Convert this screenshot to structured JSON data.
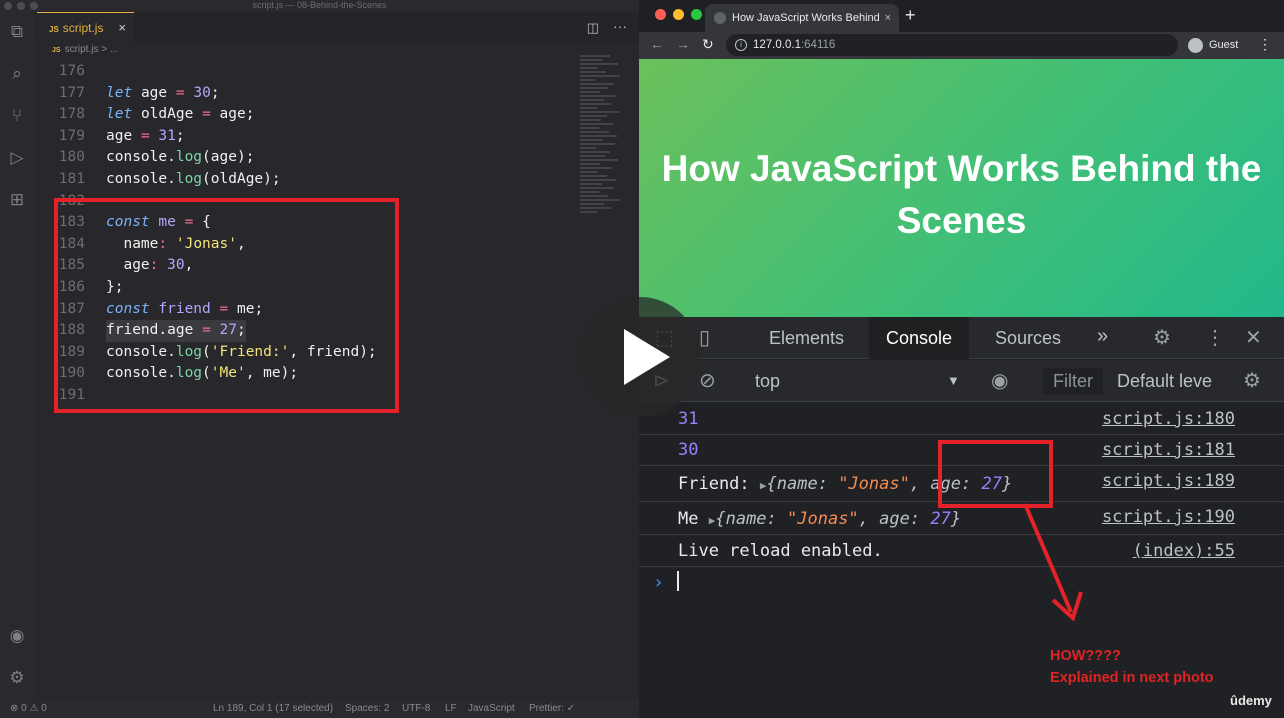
{
  "editor": {
    "window_title": "script.js — 08-Behind-the-Scenes",
    "tab_label": "script.js",
    "tab_js_badge": "JS",
    "breadcrumb_file": "script.js",
    "breadcrumb_sep": ">",
    "breadcrumb_more": "...",
    "lines": [
      {
        "n": "176"
      },
      {
        "n": "177"
      },
      {
        "n": "178"
      },
      {
        "n": "179"
      },
      {
        "n": "180"
      },
      {
        "n": "181"
      },
      {
        "n": "182"
      },
      {
        "n": "183"
      },
      {
        "n": "184"
      },
      {
        "n": "185"
      },
      {
        "n": "186"
      },
      {
        "n": "187"
      },
      {
        "n": "188"
      },
      {
        "n": "189"
      },
      {
        "n": "190"
      },
      {
        "n": "191"
      }
    ],
    "code": {
      "l177": [
        "let",
        "age",
        "=",
        "30",
        ";"
      ],
      "l178": [
        "let",
        "oldAge",
        "=",
        "age",
        ";"
      ],
      "l179": [
        "age",
        "=",
        "31",
        ";"
      ],
      "l180": [
        "console",
        ".",
        "log",
        "(age);"
      ],
      "l181": [
        "console",
        ".",
        "log",
        "(oldAge);"
      ],
      "l183": [
        "const",
        "me",
        "=",
        "{"
      ],
      "l184": [
        "name",
        ":",
        "'Jonas'",
        ","
      ],
      "l185": [
        "age",
        ":",
        "30",
        ","
      ],
      "l186": [
        "};"
      ],
      "l187": [
        "const",
        "friend",
        "=",
        "me",
        ";"
      ],
      "l188": [
        "friend",
        ".",
        "age",
        "=",
        "27",
        ";"
      ],
      "l189": [
        "console",
        ".",
        "log",
        "(",
        "'Friend:'",
        ", friend);"
      ],
      "l190": [
        "console",
        ".",
        "log",
        "(",
        "'Me'",
        ", me);"
      ]
    },
    "status": {
      "errors": "⊗ 0 ⚠ 0",
      "position": "Ln 189, Col 1 (17 selected)",
      "spaces": "Spaces: 2",
      "encoding": "UTF-8",
      "eol": "LF",
      "language": "JavaScript",
      "prettier": "Prettier: ✓"
    }
  },
  "browser": {
    "tab_title": "How JavaScript Works Behind",
    "url_host": "127.0.0.1",
    "url_port": ":64116",
    "profile": "Guest",
    "page_heading": "How JavaScript Works Behind the Scenes"
  },
  "devtools": {
    "tabs": [
      "Elements",
      "Console",
      "Sources"
    ],
    "context": "top",
    "filter_placeholder": "Filter",
    "levels": "Default leve",
    "logs": [
      {
        "text": "31",
        "src": "script.js:180"
      },
      {
        "text": "30",
        "src": "script.js:181"
      },
      {
        "label": "Friend:",
        "obj_open": "{name: ",
        "obj_name": "\"Jonas\"",
        "obj_mid": ", age: ",
        "obj_age": "27",
        "obj_close": "}",
        "src": "script.js:189"
      },
      {
        "label": "Me",
        "obj_open": "{name: ",
        "obj_name": "\"Jonas\"",
        "obj_mid": ", age: ",
        "obj_age": "27",
        "obj_close": "}",
        "src": "script.js:190"
      },
      {
        "text": "Live reload enabled.",
        "src": "(index):55"
      }
    ]
  },
  "annotation": {
    "line1": "HOW????",
    "line2": "Explained in next photo",
    "color": "#e3222a"
  },
  "watermark": "ûdemy"
}
